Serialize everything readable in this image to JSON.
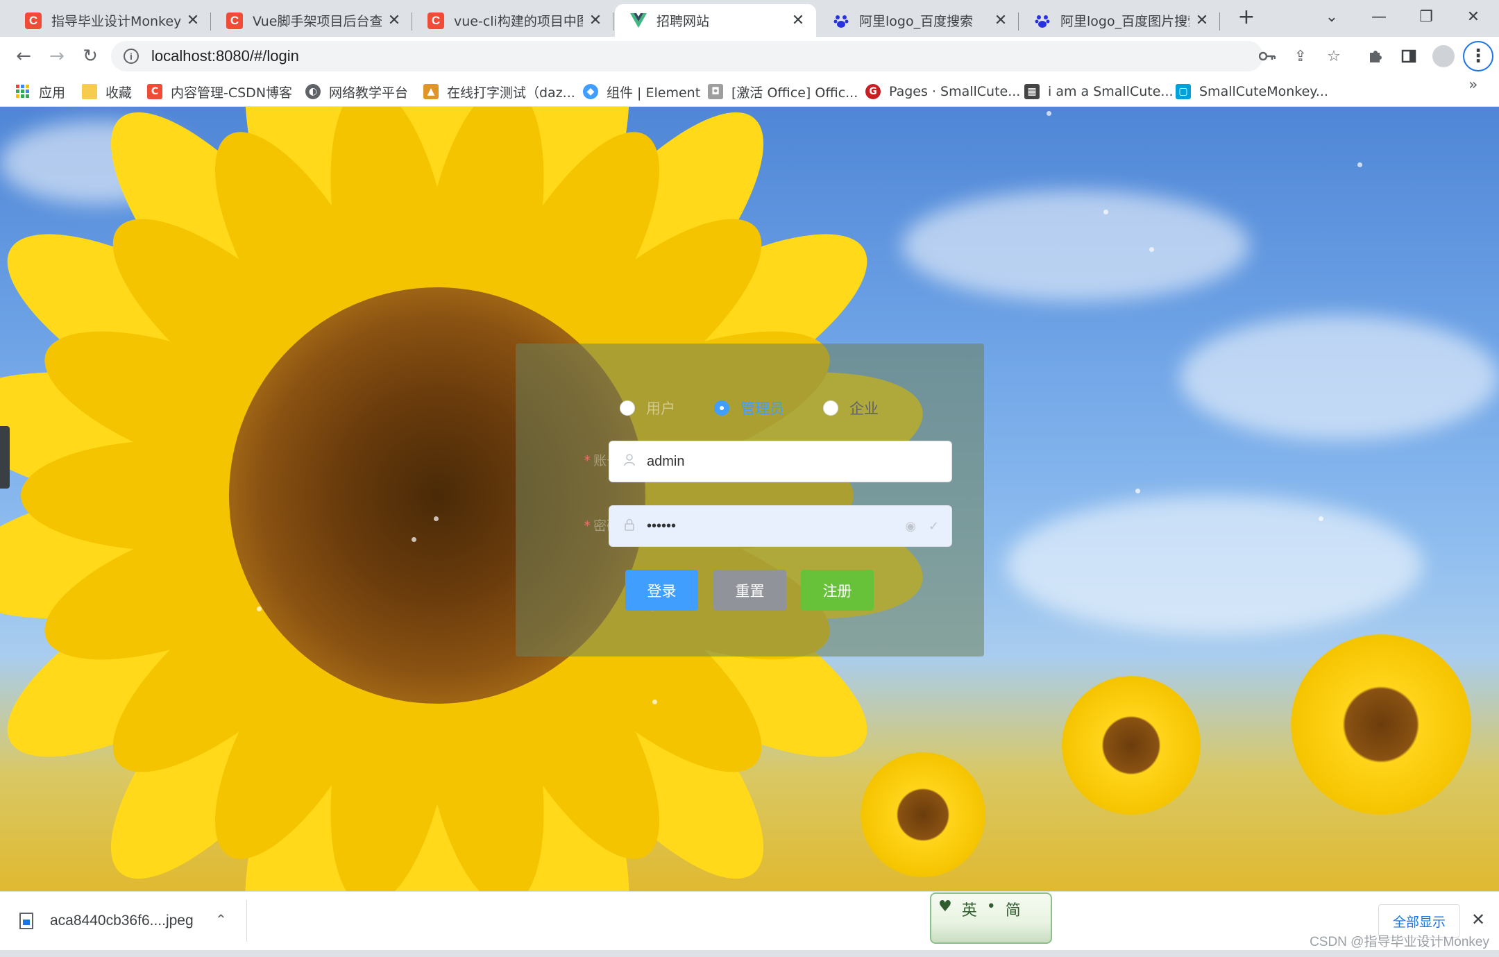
{
  "tabs": [
    {
      "title": "指导毕业设计Monkey的",
      "favicon": "csdn-icon",
      "active": false
    },
    {
      "title": "Vue脚手架项目后台查询",
      "favicon": "csdn-icon",
      "active": false
    },
    {
      "title": "vue-cli构建的项目中图片",
      "favicon": "csdn-icon",
      "active": false
    },
    {
      "title": "招聘网站",
      "favicon": "vue-icon",
      "active": true
    },
    {
      "title": "阿里logo_百度搜索",
      "favicon": "baidu-icon",
      "active": false
    },
    {
      "title": "阿里logo_百度图片搜索",
      "favicon": "baidu-icon",
      "active": false
    }
  ],
  "address": {
    "url": "localhost:8080/#/login"
  },
  "bookmarks": [
    {
      "label": "应用",
      "icon": "apps-grid-icon"
    },
    {
      "label": "收藏",
      "icon": "folder-icon"
    },
    {
      "label": "内容管理-CSDN博客",
      "icon": "csdn-icon"
    },
    {
      "label": "网络教学平台",
      "icon": "globe-icon"
    },
    {
      "label": "在线打字测试（daz...",
      "icon": "typing-icon"
    },
    {
      "label": "组件 | Element",
      "icon": "element-icon"
    },
    {
      "label": "[激活 Office] Offic...",
      "icon": "office-icon"
    },
    {
      "label": "Pages · SmallCute...",
      "icon": "gitee-icon"
    },
    {
      "label": "i am a SmallCute...",
      "icon": "qr-icon"
    },
    {
      "label": "SmallCuteMonkey...",
      "icon": "bilibili-icon"
    }
  ],
  "login": {
    "roles": [
      {
        "label": "用户",
        "checked": false
      },
      {
        "label": "管理员",
        "checked": true
      },
      {
        "label": "企业",
        "checked": false
      }
    ],
    "username_label": "账号",
    "username_value": "admin",
    "password_label": "密码",
    "password_value": "••••••",
    "login_button": "登录",
    "reset_button": "重置",
    "register_button": "注册",
    "colors": {
      "primary": "#409eff",
      "info": "#909399",
      "success": "#67c23a"
    }
  },
  "download": {
    "filename": "aca8440cb36f6....jpeg",
    "show_all": "全部显示"
  },
  "ime": {
    "chars": [
      "英",
      "简"
    ]
  },
  "watermark": "CSDN @指导毕业设计Monkey"
}
